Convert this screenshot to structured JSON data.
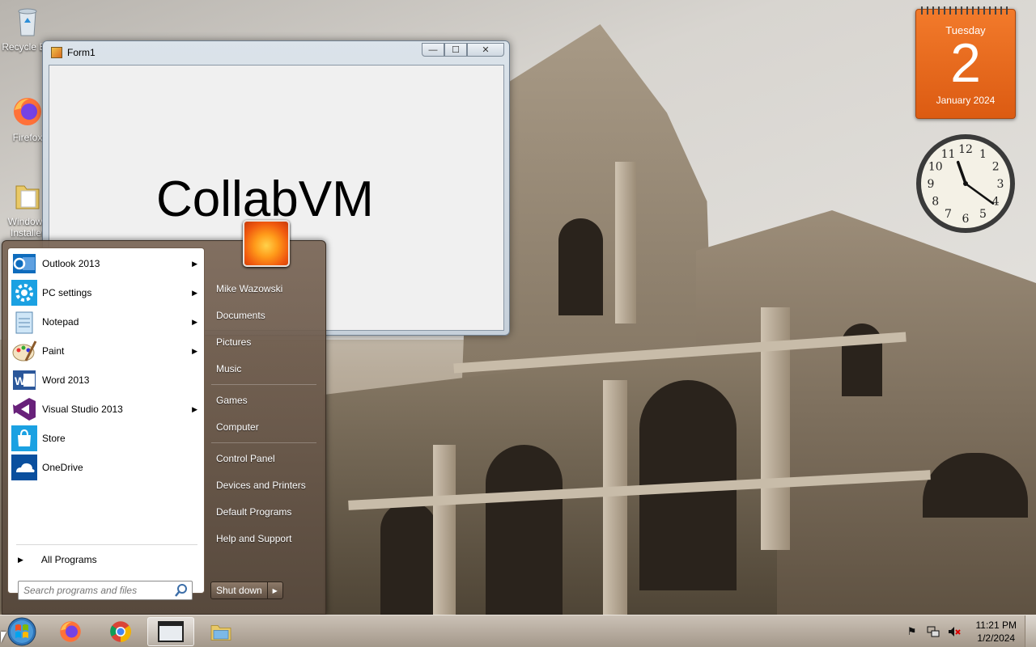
{
  "desktop": {
    "icons": [
      {
        "label": "Recycle Bin",
        "icon": "recycle-bin-icon"
      },
      {
        "label": "Firefox",
        "icon": "firefox-icon"
      },
      {
        "label": "Windows Installer",
        "icon": "folder-icon"
      }
    ]
  },
  "form1": {
    "title": "Form1",
    "label_text": "CollabVM",
    "caption_buttons": {
      "minimize": "—",
      "maximize": "☐",
      "close": "✕"
    }
  },
  "start_menu": {
    "programs": [
      {
        "label": "Outlook 2013",
        "icon": "outlook-icon",
        "has_submenu": true
      },
      {
        "label": "PC settings",
        "icon": "gear-icon",
        "has_submenu": true
      },
      {
        "label": "Notepad",
        "icon": "notepad-icon",
        "has_submenu": true
      },
      {
        "label": "Paint",
        "icon": "paint-icon",
        "has_submenu": true
      },
      {
        "label": "Word 2013",
        "icon": "word-icon",
        "has_submenu": false
      },
      {
        "label": "Visual Studio 2013",
        "icon": "visual-studio-icon",
        "has_submenu": true
      },
      {
        "label": "Store",
        "icon": "store-icon",
        "has_submenu": false
      },
      {
        "label": "OneDrive",
        "icon": "onedrive-icon",
        "has_submenu": false
      }
    ],
    "all_programs": "All Programs",
    "search_placeholder": "Search programs and files",
    "right_items": [
      "Mike Wazowski",
      "Documents",
      "Pictures",
      "Music",
      "Games",
      "Computer",
      "Control Panel",
      "Devices and Printers",
      "Default Programs",
      "Help and Support"
    ],
    "shutdown_label": "Shut down",
    "shutdown_arrow": "▶"
  },
  "calendar_gadget": {
    "weekday": "Tuesday",
    "day": "2",
    "month_year": "January 2024"
  },
  "clock_gadget": {
    "numerals": [
      "12",
      "1",
      "2",
      "3",
      "4",
      "5",
      "6",
      "7",
      "8",
      "9",
      "10",
      "11"
    ],
    "hour": 11,
    "minute": 21
  },
  "taskbar": {
    "pinned": [
      {
        "name": "firefox",
        "icon": "firefox-icon",
        "active": false
      },
      {
        "name": "chrome",
        "icon": "chrome-icon",
        "active": false
      },
      {
        "name": "form1",
        "icon": "window-icon",
        "active": true
      },
      {
        "name": "explorer",
        "icon": "folder-icon",
        "active": false
      }
    ],
    "tray": {
      "time": "11:21 PM",
      "date": "1/2/2024",
      "icons": [
        "flag-icon",
        "network-icon",
        "volume-muted-icon"
      ]
    }
  },
  "colors": {
    "calendar_orange": "#e8651d",
    "start_menu_brown": "#6e5a4a",
    "window_frame": "#c9d3dd"
  }
}
